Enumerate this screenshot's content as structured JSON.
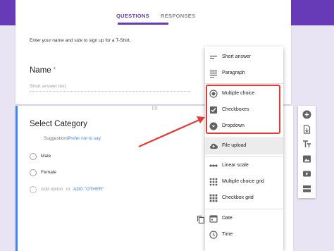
{
  "tabs": {
    "questions": "QUESTIONS",
    "responses": "RESPONSES"
  },
  "form": {
    "description": "Enter your name and size to sign up for a T-Shirt.",
    "name_question": "Name",
    "required_mark": "*",
    "short_answer_placeholder": "Short answer text"
  },
  "category": {
    "title": "Select Category",
    "suggestions_label": "Suggestions:",
    "suggestion_link": "Prefer not to say",
    "options": [
      "Male",
      "Female"
    ],
    "add_option": "Add option",
    "or": "or",
    "add_other": "ADD \"OTHER\""
  },
  "menu": {
    "items": [
      {
        "label": "Short answer",
        "icon": "short-answer-icon"
      },
      {
        "label": "Paragraph",
        "icon": "paragraph-icon"
      },
      {
        "label": "Multiple choice",
        "icon": "radio-icon"
      },
      {
        "label": "Checkboxes",
        "icon": "checkbox-icon"
      },
      {
        "label": "Dropdown",
        "icon": "dropdown-icon"
      },
      {
        "label": "File upload",
        "icon": "cloud-upload-icon"
      },
      {
        "label": "Linear scale",
        "icon": "linear-scale-icon"
      },
      {
        "label": "Multiple choice grid",
        "icon": "grid-icon"
      },
      {
        "label": "Checkbox grid",
        "icon": "grid-icon"
      },
      {
        "label": "Date",
        "icon": "calendar-icon"
      },
      {
        "label": "Time",
        "icon": "clock-icon"
      }
    ]
  },
  "side_toolbar": [
    "add-question-icon",
    "import-questions-icon",
    "add-title-icon",
    "add-image-icon",
    "add-video-icon",
    "add-section-icon"
  ],
  "colors": {
    "brand": "#673ab7",
    "accent_blue": "#4285f4",
    "annotation_red": "#e53935"
  }
}
